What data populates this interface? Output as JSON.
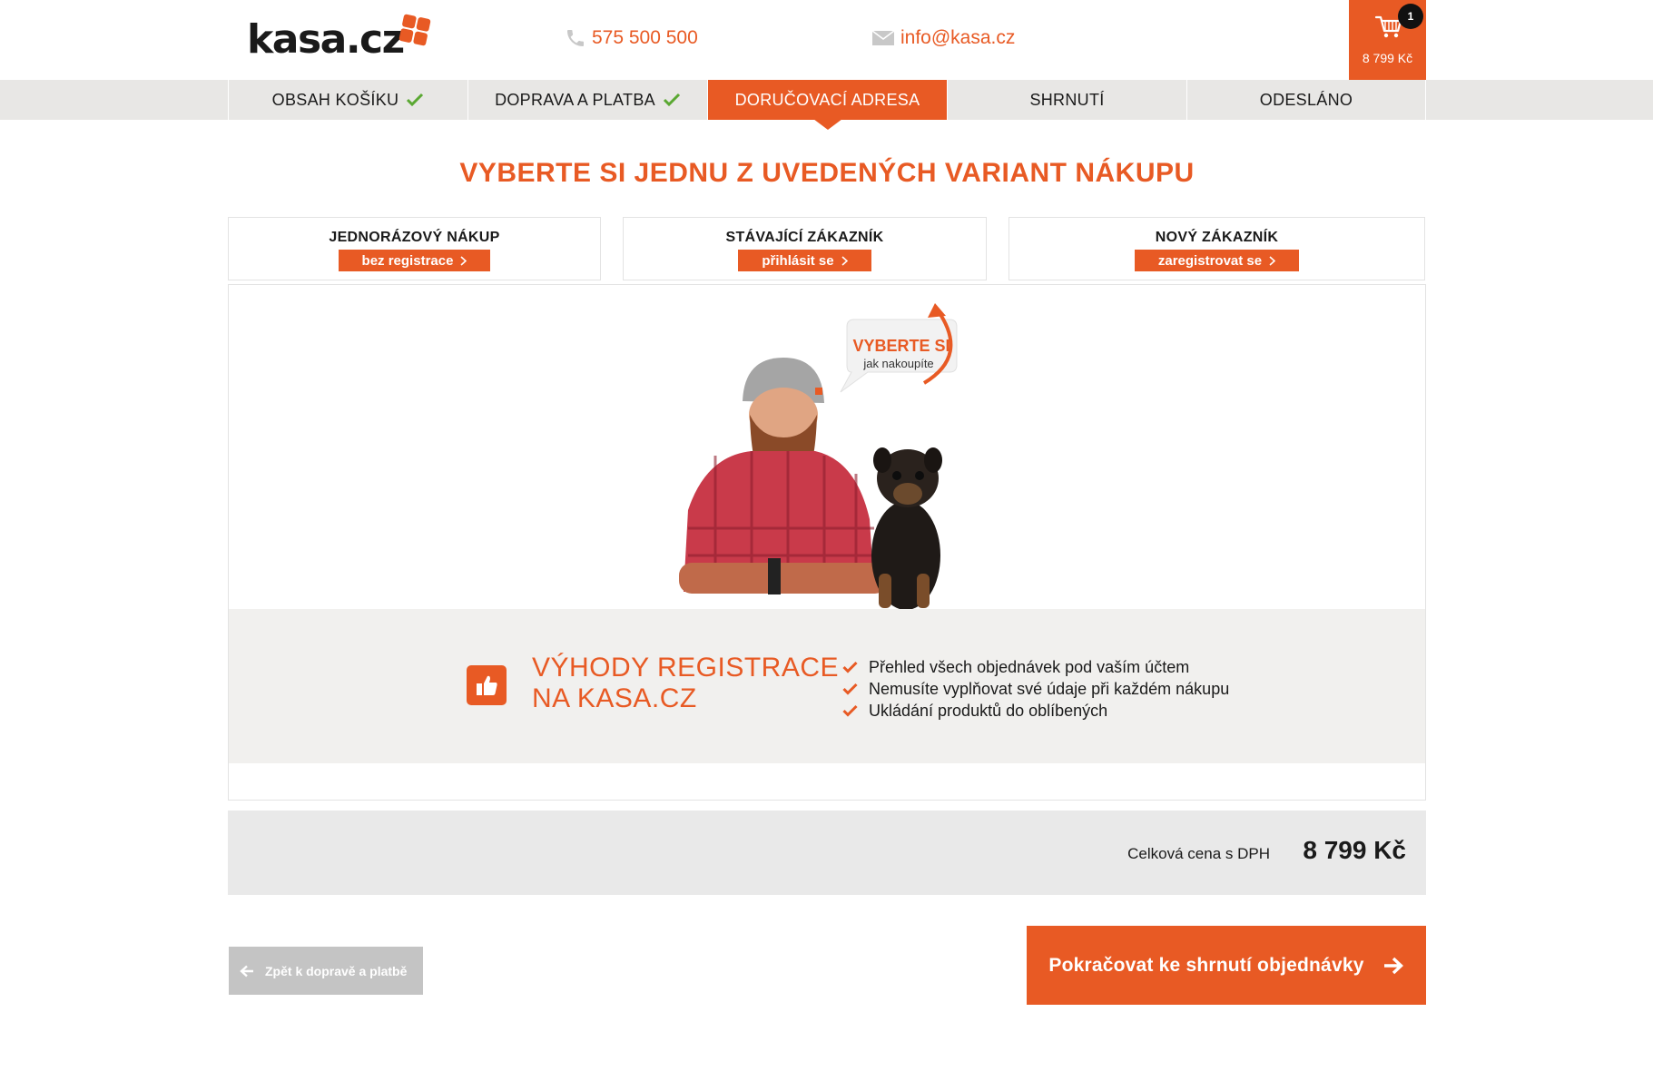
{
  "header": {
    "logo_text": "kasa.cz",
    "phone": "575 500 500",
    "email": "info@kasa.cz",
    "cart": {
      "count": "1",
      "price": "8 799 Kč",
      "icon": "cart-icon"
    }
  },
  "steps": [
    {
      "label": "OBSAH KOŠÍKU",
      "state": "done"
    },
    {
      "label": "DOPRAVA A PLATBA",
      "state": "done"
    },
    {
      "label": "DORUČOVACÍ ADRESA",
      "state": "active"
    },
    {
      "label": "SHRNUTÍ",
      "state": "pending"
    },
    {
      "label": "ODESLÁNO",
      "state": "pending"
    }
  ],
  "main": {
    "title": "VYBERTE SI JEDNU Z UVEDENÝCH VARIANT NÁKUPU",
    "options": [
      {
        "title": "JEDNORÁZOVÝ NÁKUP",
        "button": "bez registrace"
      },
      {
        "title": "STÁVAJÍCÍ ZÁKAZNÍK",
        "button": "přihlásit se"
      },
      {
        "title": "NOVÝ ZÁKAZNÍK",
        "button": "zaregistrovat se"
      }
    ],
    "bubble": {
      "line1": "VYBERTE SI",
      "line2": "jak nakoupíte"
    },
    "benefits": {
      "title_line1": "VÝHODY REGISTRACE",
      "title_line2": "NA KASA.CZ",
      "items": [
        "Přehled všech objednávek pod vaším účtem",
        "Nemusíte vyplňovat své údaje při každém nákupu",
        "Ukládání produktů do oblíbených"
      ]
    }
  },
  "total": {
    "label": "Celková cena s DPH",
    "value": "8 799 Kč"
  },
  "actions": {
    "back_label": "Zpět k dopravě a platbě",
    "next_label": "Pokračovat ke shrnutí objednávky"
  },
  "colors": {
    "accent": "#e85a24",
    "check_green": "#5aa832",
    "step_bar": "#e8e7e5"
  }
}
